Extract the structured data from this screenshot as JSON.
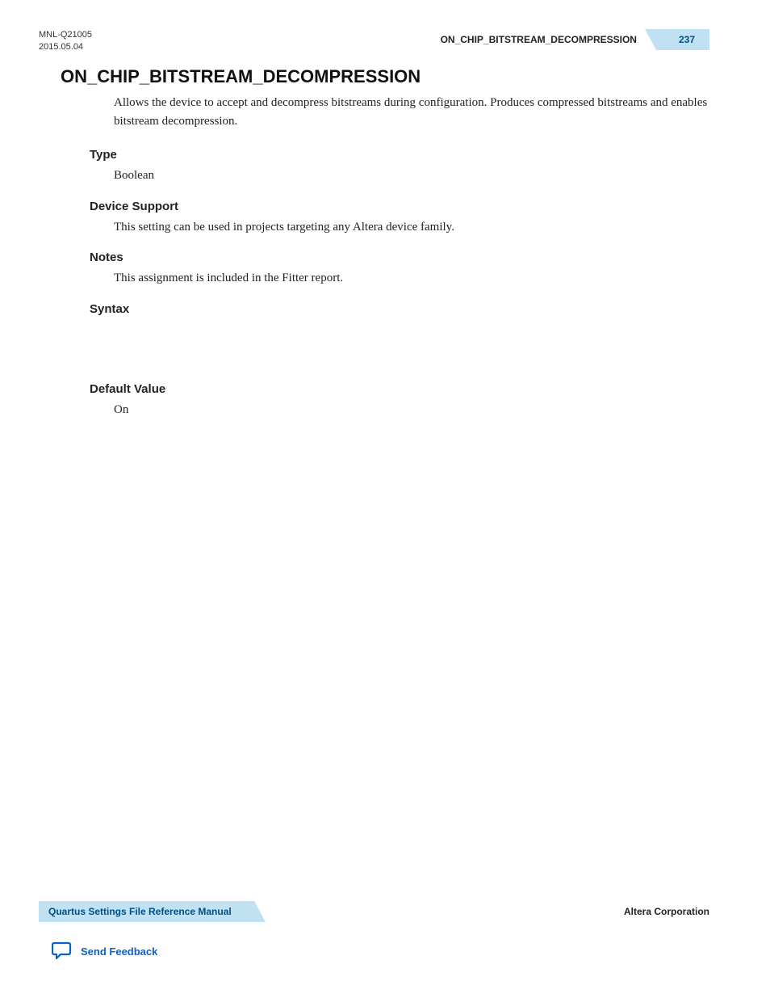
{
  "header": {
    "doc_id": "MNL-Q21005",
    "date": "2015.05.04",
    "topic": "ON_CHIP_BITSTREAM_DECOMPRESSION",
    "page_number": "237"
  },
  "title": "ON_CHIP_BITSTREAM_DECOMPRESSION",
  "intro": "Allows the device to accept and decompress bitstreams during configuration. Produces compressed bitstreams and enables bitstream decompression.",
  "sections": {
    "type": {
      "heading": "Type",
      "body": "Boolean"
    },
    "device_support": {
      "heading": "Device Support",
      "body": "This setting can be used in projects targeting any Altera device family."
    },
    "notes": {
      "heading": "Notes",
      "body": "This assignment is included in the Fitter report."
    },
    "syntax": {
      "heading": "Syntax",
      "body": ""
    },
    "default_value": {
      "heading": "Default Value",
      "body": "On"
    }
  },
  "footer": {
    "manual_title": "Quartus Settings File Reference Manual",
    "company": "Altera Corporation",
    "feedback_label": "Send Feedback"
  }
}
